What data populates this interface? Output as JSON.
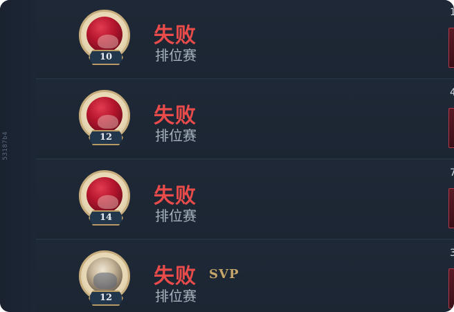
{
  "side": {
    "vertical_text": "53187b4"
  },
  "matches": [
    {
      "result": "失败",
      "mode": "排位赛",
      "level": "10",
      "svp": "",
      "hero_icon": "rose-hero-portrait-icon",
      "right_digit": "1"
    },
    {
      "result": "失败",
      "mode": "排位赛",
      "level": "12",
      "svp": "",
      "hero_icon": "rose-hero-portrait-icon",
      "right_digit": "4"
    },
    {
      "result": "失败",
      "mode": "排位赛",
      "level": "14",
      "svp": "",
      "hero_icon": "rose-hero-portrait-icon",
      "right_digit": "7"
    },
    {
      "result": "失败",
      "mode": "排位赛",
      "level": "12",
      "svp": "SVP",
      "hero_icon": "warrior-hero-portrait-icon",
      "right_digit": "3"
    }
  ],
  "colors": {
    "defeat": "#e94b4b",
    "svp": "#c6a66a",
    "mode": "#a8b3bf",
    "frame": "#c8ad7e",
    "background": "#1e2836"
  }
}
